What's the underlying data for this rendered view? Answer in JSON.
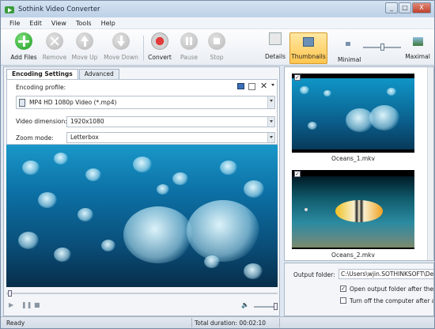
{
  "window": {
    "title": "Sothink Video Converter",
    "controls": [
      "_",
      "□",
      "X"
    ]
  },
  "menu": [
    "File",
    "Edit",
    "View",
    "Tools",
    "Help"
  ],
  "toolbar": {
    "add_files": "Add Files",
    "remove": "Remove",
    "move_up": "Move Up",
    "move_down": "Move Down",
    "convert": "Convert",
    "pause": "Pause",
    "stop": "Stop",
    "details": "Details",
    "thumbnails": "Thumbnails",
    "minimal": "Minimal",
    "maximal": "Maximal"
  },
  "tabs": [
    "Encoding Settings",
    "Advanced"
  ],
  "encoding": {
    "profile_label": "Encoding profile:",
    "profile_value": "MP4 HD 1080p Video (*.mp4)",
    "dimension_label": "Video dimension:",
    "dimension_value": "1920x1080",
    "zoom_label": "Zoom mode:",
    "zoom_value": "Letterbox"
  },
  "files": [
    {
      "name": "Oceans_1.mkv",
      "checked": true
    },
    {
      "name": "Oceans_2.mkv",
      "checked": true
    }
  ],
  "output": {
    "folder_label": "Output folder:",
    "folder_value": "C:\\Users\\wjin.SOTHINKSOFT\\Deskt",
    "open_after_label": "Open output folder after the co",
    "open_after_checked": true,
    "turn_off_label": "Turn off the computer after all t",
    "turn_off_checked": false
  },
  "status": {
    "ready": "Ready",
    "total_duration": "Total duration: 00:02:10"
  }
}
